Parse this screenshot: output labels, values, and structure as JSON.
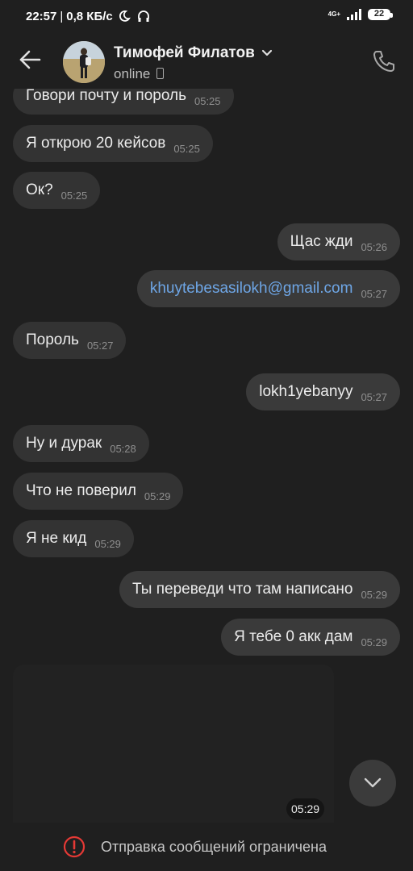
{
  "status_bar": {
    "time": "22:57",
    "separator": "|",
    "speed": "0,8 КБ/с",
    "network": "4G+",
    "battery": "22",
    "icons": [
      "moon-icon",
      "headphones-icon",
      "signal-icon",
      "battery-icon"
    ]
  },
  "header": {
    "contact_name": "Тимофей Филатов",
    "status": "online",
    "icons": [
      "back-arrow-icon",
      "chevron-down-icon",
      "mobile-device-icon",
      "phone-call-icon"
    ]
  },
  "messages": [
    {
      "text": "Говори почту и пороль",
      "time": "05:25",
      "direction": "in"
    },
    {
      "text": "Я открою 20 кейсов",
      "time": "05:25",
      "direction": "in"
    },
    {
      "text": "Ок?",
      "time": "05:25",
      "direction": "in"
    },
    {
      "text": "Щас жди",
      "time": "05:26",
      "direction": "out"
    },
    {
      "text": "khuytebesasilokh@gmail.com",
      "time": "05:27",
      "direction": "out"
    },
    {
      "text": "Пороль",
      "time": "05:27",
      "direction": "in"
    },
    {
      "text": "lokh1yebanyy",
      "time": "05:27",
      "direction": "out"
    },
    {
      "text": "Ну и дурак",
      "time": "05:28",
      "direction": "in"
    },
    {
      "text": "Что не поверил",
      "time": "05:29",
      "direction": "in"
    },
    {
      "text": "Я не кид",
      "time": "05:29",
      "direction": "in"
    },
    {
      "text": "Ты переведи что там написано",
      "time": "05:29",
      "direction": "out"
    },
    {
      "text": "Я тебе 0 акк дам",
      "time": "05:29",
      "direction": "out"
    }
  ],
  "media": {
    "time": "05:29"
  },
  "footer": {
    "restriction_text": "Отправка сообщений ограничена",
    "accent_warning": "#e53935",
    "link_color": "#6ea6e6"
  }
}
